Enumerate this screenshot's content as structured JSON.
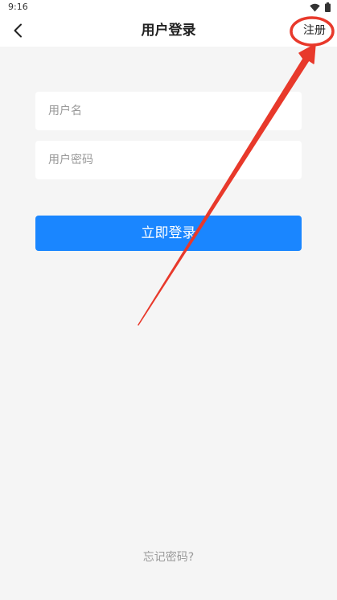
{
  "status_bar": {
    "time": "9:16",
    "icons": [
      "wifi-icon",
      "battery-icon"
    ]
  },
  "app_bar": {
    "back_icon": "chevron-left-icon",
    "title": "用户登录",
    "register_label": "注册"
  },
  "form": {
    "username_placeholder": "用户名",
    "username_value": "",
    "password_placeholder": "用户密码",
    "password_value": ""
  },
  "login_button": {
    "label": "立即登录"
  },
  "forgot_password": {
    "label": "忘记密码?"
  },
  "colors": {
    "primary": "#1a86ff",
    "background": "#f5f5f5",
    "annotation": "#e8392b"
  }
}
